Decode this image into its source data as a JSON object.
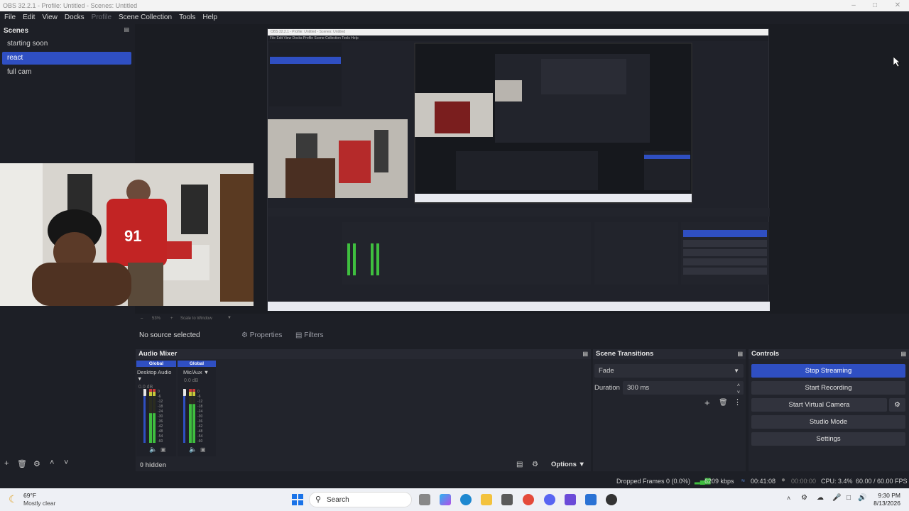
{
  "window": {
    "title": "OBS 32.2.1 - Profile: Untitled - Scenes: Untitled"
  },
  "menu": {
    "items": [
      "File",
      "Edit",
      "View",
      "Docks",
      "Profile",
      "Scene Collection",
      "Tools",
      "Help"
    ]
  },
  "scenes": {
    "title": "Scenes",
    "items": [
      "starting soon",
      "react",
      "full cam"
    ],
    "selected": "react"
  },
  "preview": {
    "zoom": "53%",
    "scale_mode": "Scale to Window",
    "nested_title": "OBS 32.2.1 - Profile: Untitled - Scenes: Untitled"
  },
  "sources": {
    "status": "No source selected",
    "properties_label": "Properties",
    "filters_label": "Filters"
  },
  "audio_mixer": {
    "title": "Audio Mixer",
    "channels": [
      {
        "tag": "Global",
        "name": "Desktop Audio",
        "db": "0.0 dB",
        "level": 0.55
      },
      {
        "tag": "Global",
        "name": "Mic/Aux",
        "db": "0.0 dB",
        "level": 0.72
      }
    ],
    "scale_labels": [
      "0",
      "-6",
      "-12",
      "-18",
      "-24",
      "-30",
      "-36",
      "-42",
      "-48",
      "-54",
      "-60"
    ],
    "hidden_label": "0 hidden",
    "options_label": "Options"
  },
  "transitions": {
    "title": "Scene Transitions",
    "selected": "Fade",
    "duration_label": "Duration",
    "duration_value": "300 ms"
  },
  "controls": {
    "title": "Controls",
    "stop_streaming": "Stop Streaming",
    "start_recording": "Start Recording",
    "start_virtual_camera": "Start Virtual Camera",
    "studio_mode": "Studio Mode",
    "settings": "Settings"
  },
  "status": {
    "dropped_frames": "Dropped Frames 0 (0.0%)",
    "bitrate": "6209 kbps",
    "stream_time": "00:41:08",
    "record_time": "00:00:00",
    "cpu": "CPU: 3.4%",
    "fps": "60.00 / 60.00 FPS"
  },
  "taskbar": {
    "weather_temp": "69°F",
    "weather_desc": "Mostly clear",
    "search_placeholder": "Search",
    "time": "9:30 PM",
    "date": "8/13/2026"
  },
  "colors": {
    "accent": "#2f4fc2",
    "bg": "#1d1f26",
    "dock": "#22242c",
    "meter_green": "#3fbf3f",
    "meter_yellow": "#c9c93a",
    "meter_red": "#c43a3a"
  }
}
